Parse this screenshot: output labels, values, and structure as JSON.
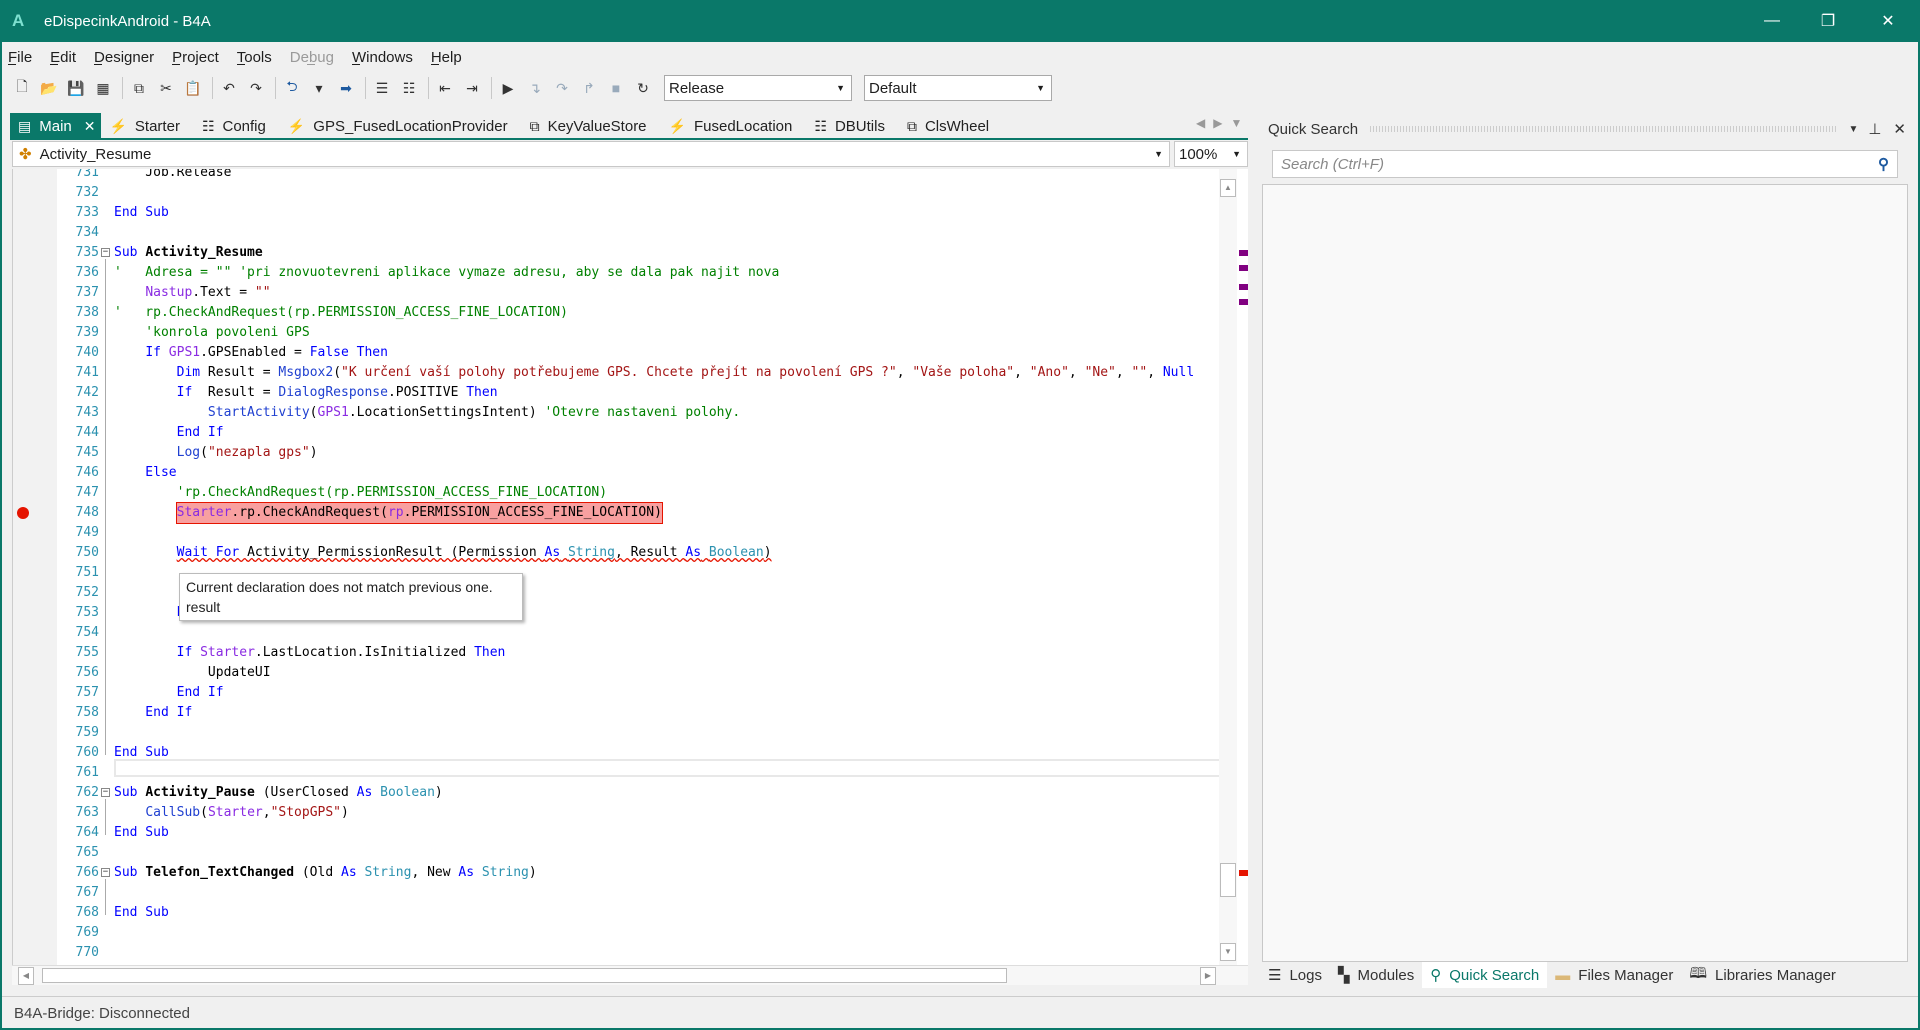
{
  "window": {
    "title": "eDispecinkAndroid - B4A",
    "logo": "A",
    "minimize": "—",
    "restore": "❐",
    "close": "✕"
  },
  "menu": [
    "File",
    "Edit",
    "Designer",
    "Project",
    "Tools",
    "Debug",
    "Windows",
    "Help"
  ],
  "toolbar": {
    "icons": [
      "new-file-icon",
      "open-icon",
      "save-icon",
      "save-all-icon",
      "copy-icon",
      "cut-icon",
      "paste-icon",
      "undo-icon",
      "redo-icon",
      "back-icon",
      "dropdown-icon",
      "forward-icon",
      "comment-icon",
      "uncomment-icon",
      "outdent-icon",
      "indent-icon",
      "run-icon",
      "step-in-icon",
      "step-over-icon",
      "step-out-icon",
      "stop-icon",
      "restart-icon"
    ],
    "build_config": "Release",
    "build_target": "Default"
  },
  "tabs": [
    {
      "label": "Main",
      "icon": "module-icon",
      "active": true
    },
    {
      "label": "Starter",
      "icon": "service-icon"
    },
    {
      "label": "Config",
      "icon": "code-module-icon"
    },
    {
      "label": "GPS_FusedLocationProvider",
      "icon": "service-icon"
    },
    {
      "label": "KeyValueStore",
      "icon": "class-icon"
    },
    {
      "label": "FusedLocation",
      "icon": "service-icon"
    },
    {
      "label": "DBUtils",
      "icon": "code-module-icon"
    },
    {
      "label": "ClsWheel",
      "icon": "class-icon"
    }
  ],
  "sub_selector": "Activity_Resume",
  "zoom": "100%",
  "code": [
    {
      "n": "731",
      "t": [
        [
          "    Job.Release",
          ""
        ]
      ]
    },
    {
      "n": "732",
      "t": []
    },
    {
      "n": "733",
      "t": [
        [
          "End Sub",
          "kw"
        ]
      ]
    },
    {
      "n": "734",
      "t": []
    },
    {
      "n": "735",
      "fold": true,
      "t": [
        [
          "Sub ",
          "kw"
        ],
        [
          "Activity_Resume",
          "bold"
        ]
      ]
    },
    {
      "n": "736",
      "t": [
        [
          "'   Adresa = \"\" 'pri znovuotevreni aplikace vymaze adresu, aby se dala pak najit nova",
          "cm"
        ]
      ]
    },
    {
      "n": "737",
      "t": [
        [
          "    ",
          ""
        ],
        [
          "Nastup",
          "obj"
        ],
        [
          ".Text = ",
          ""
        ],
        [
          "\"\"",
          "str"
        ]
      ]
    },
    {
      "n": "738",
      "t": [
        [
          "'   rp.CheckAndRequest(rp.PERMISSION_ACCESS_FINE_LOCATION)",
          "cm"
        ]
      ]
    },
    {
      "n": "739",
      "t": [
        [
          "    'konrola povoleni GPS",
          "cm"
        ]
      ]
    },
    {
      "n": "740",
      "t": [
        [
          "    ",
          ""
        ],
        [
          "If ",
          "kw"
        ],
        [
          "GPS1",
          "obj"
        ],
        [
          ".GPSEnabled = ",
          ""
        ],
        [
          "False Then",
          "kw"
        ]
      ]
    },
    {
      "n": "741",
      "t": [
        [
          "        ",
          ""
        ],
        [
          "Dim",
          "kw"
        ],
        [
          " Result = ",
          ""
        ],
        [
          "Msgbox2",
          "fn"
        ],
        [
          "(",
          ""
        ],
        [
          "\"K určení vaší polohy potřebujeme GPS. Chcete přejít na povolení GPS ?\"",
          "str"
        ],
        [
          ", ",
          ""
        ],
        [
          "\"Vaše poloha\"",
          "str"
        ],
        [
          ", ",
          ""
        ],
        [
          "\"Ano\"",
          "str"
        ],
        [
          ", ",
          ""
        ],
        [
          "\"Ne\"",
          "str"
        ],
        [
          ", ",
          ""
        ],
        [
          "\"\"",
          "str"
        ],
        [
          ", ",
          ""
        ],
        [
          "Null",
          "kw"
        ]
      ]
    },
    {
      "n": "742",
      "t": [
        [
          "        ",
          ""
        ],
        [
          "If",
          "kw"
        ],
        [
          "  Result = ",
          ""
        ],
        [
          "DialogResponse",
          "fn"
        ],
        [
          ".POSITIVE ",
          ""
        ],
        [
          "Then",
          "kw"
        ]
      ]
    },
    {
      "n": "743",
      "t": [
        [
          "            ",
          ""
        ],
        [
          "StartActivity",
          "fn"
        ],
        [
          "(",
          ""
        ],
        [
          "GPS1",
          "obj"
        ],
        [
          ".LocationSettingsIntent) ",
          ""
        ],
        [
          "'Otevre nastaveni polohy.",
          "cm"
        ]
      ]
    },
    {
      "n": "744",
      "t": [
        [
          "        End If",
          "kw"
        ]
      ]
    },
    {
      "n": "745",
      "t": [
        [
          "        ",
          ""
        ],
        [
          "Log",
          "fn"
        ],
        [
          "(",
          ""
        ],
        [
          "\"nezapla gps\"",
          "str"
        ],
        [
          ")",
          ""
        ]
      ]
    },
    {
      "n": "746",
      "t": [
        [
          "    Else",
          "kw"
        ]
      ]
    },
    {
      "n": "747",
      "t": [
        [
          "        'rp.CheckAndRequest(rp.PERMISSION_ACCESS_FINE_LOCATION)",
          "cm"
        ]
      ]
    },
    {
      "n": "748",
      "bp": true,
      "t": [
        [
          "        ",
          ""
        ],
        [
          "Starter",
          "obj"
        ],
        [
          ".rp.CheckAndRequest(",
          ""
        ],
        [
          "rp",
          "obj"
        ],
        [
          ".PERMISSION_ACCESS_FINE_LOCATION)",
          ""
        ]
      ]
    },
    {
      "n": "749",
      "t": []
    },
    {
      "n": "750",
      "sq": true,
      "t": [
        [
          "        ",
          ""
        ],
        [
          "Wait For",
          "kw"
        ],
        [
          " Activity_PermissionResult (Permission ",
          ""
        ],
        [
          "As",
          "kw"
        ],
        [
          " ",
          ""
        ],
        [
          "String",
          "typ"
        ],
        [
          ", Result ",
          ""
        ],
        [
          "As",
          "kw"
        ],
        [
          " ",
          ""
        ],
        [
          "Boolean",
          "typ"
        ],
        [
          ")",
          ""
        ]
      ]
    },
    {
      "n": "751",
      "t": []
    },
    {
      "n": "752",
      "t": []
    },
    {
      "n": "753",
      "t": [
        [
          "        End If",
          "kw"
        ]
      ]
    },
    {
      "n": "754",
      "t": []
    },
    {
      "n": "755",
      "t": [
        [
          "        ",
          ""
        ],
        [
          "If ",
          "kw"
        ],
        [
          "Starter",
          "obj"
        ],
        [
          ".LastLocation.IsInitialized ",
          ""
        ],
        [
          "Then",
          "kw"
        ]
      ]
    },
    {
      "n": "756",
      "t": [
        [
          "            UpdateUI",
          ""
        ]
      ]
    },
    {
      "n": "757",
      "t": [
        [
          "        End If",
          "kw"
        ]
      ]
    },
    {
      "n": "758",
      "t": [
        [
          "    End If",
          "kw"
        ]
      ]
    },
    {
      "n": "759",
      "t": []
    },
    {
      "n": "760",
      "t": [
        [
          "End Sub",
          "kw"
        ]
      ]
    },
    {
      "n": "761",
      "t": []
    },
    {
      "n": "762",
      "fold": true,
      "t": [
        [
          "Sub ",
          "kw"
        ],
        [
          "Activity_Pause",
          "bold"
        ],
        [
          " (UserClosed ",
          ""
        ],
        [
          "As",
          "kw"
        ],
        [
          " ",
          ""
        ],
        [
          "Boolean",
          "typ"
        ],
        [
          ")",
          ""
        ]
      ]
    },
    {
      "n": "763",
      "t": [
        [
          "    ",
          ""
        ],
        [
          "CallSub",
          "fn"
        ],
        [
          "(",
          ""
        ],
        [
          "Starter",
          "obj"
        ],
        [
          ",",
          ""
        ],
        [
          "\"StopGPS\"",
          "str"
        ],
        [
          ")",
          ""
        ]
      ]
    },
    {
      "n": "764",
      "t": [
        [
          "End Sub",
          "kw"
        ]
      ]
    },
    {
      "n": "765",
      "t": []
    },
    {
      "n": "766",
      "fold": true,
      "t": [
        [
          "Sub ",
          "kw"
        ],
        [
          "Telefon_TextChanged",
          "bold"
        ],
        [
          " (Old ",
          ""
        ],
        [
          "As",
          "kw"
        ],
        [
          " ",
          ""
        ],
        [
          "String",
          "typ"
        ],
        [
          ", New ",
          ""
        ],
        [
          "As",
          "kw"
        ],
        [
          " ",
          ""
        ],
        [
          "String",
          "typ"
        ],
        [
          ")",
          ""
        ]
      ]
    },
    {
      "n": "767",
      "t": []
    },
    {
      "n": "768",
      "t": [
        [
          "End Sub",
          "kw"
        ]
      ]
    },
    {
      "n": "769",
      "t": []
    },
    {
      "n": "770",
      "t": []
    }
  ],
  "tooltip": {
    "line1": "Current declaration does not match previous one.",
    "line2": "result"
  },
  "quick_search": {
    "title": "Quick Search",
    "placeholder": "Search (Ctrl+F)",
    "value": ""
  },
  "bottom_tabs": [
    {
      "label": "Logs",
      "icon": "logs-icon"
    },
    {
      "label": "Modules",
      "icon": "modules-icon"
    },
    {
      "label": "Quick Search",
      "icon": "search-icon",
      "active": true
    },
    {
      "label": "Files Manager",
      "icon": "folder-icon"
    },
    {
      "label": "Libraries Manager",
      "icon": "book-icon"
    }
  ],
  "status": "B4A-Bridge: Disconnected",
  "colors": {
    "accent": "#0a7869",
    "breakpoint": "#e51400",
    "keyword": "#0000ff",
    "comment": "#008000",
    "string": "#a31515",
    "overview_marker": "#800080"
  }
}
